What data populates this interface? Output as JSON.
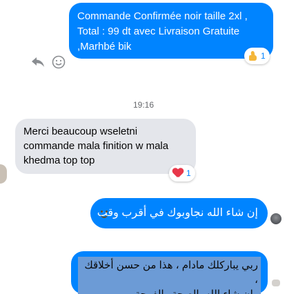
{
  "messages": {
    "m1": {
      "lines": [
        "Commande Confirmée noir taille 2xl ,",
        "Total : 99 dt avec Livraison Gratuite",
        ",Marhbé bik"
      ]
    },
    "m2": {
      "lines": [
        "Merci beaucoup wseletni",
        "commande mala finition w mala",
        "khedma top top"
      ]
    },
    "m3": {
      "text": "إن شاء الله نجاوبوك في أقرب وقت"
    },
    "m4": {
      "lines": [
        "ربي يباركلك مادام ، هذا من حسن أخلاقك ،",
        "وإن شاء الله بالصحة والفرحة"
      ]
    }
  },
  "reactions": {
    "r1": {
      "count": "1",
      "icon": "thumbs-up-icon"
    },
    "r2": {
      "count": "1",
      "icon": "heart-icon"
    }
  },
  "timestamp": "19:16",
  "tools": {
    "reply_icon": "reply-icon",
    "emoji_icon": "smiley-icon"
  },
  "colors": {
    "outgoing": "#0084ff",
    "incoming": "#e4e6eb",
    "selection": "#6c9bd6",
    "muted": "#65676b"
  }
}
